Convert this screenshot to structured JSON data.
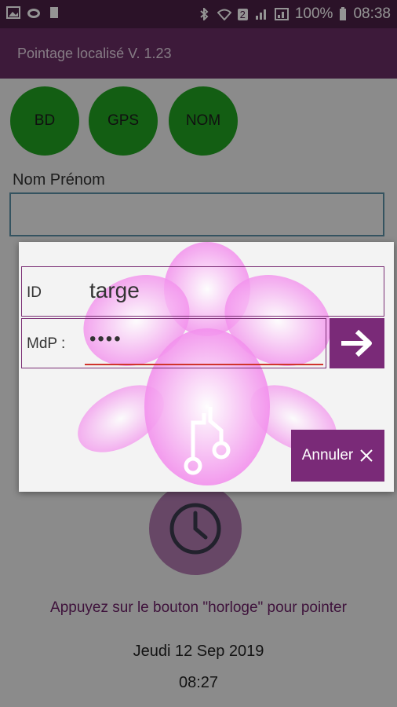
{
  "status_bar": {
    "battery": "100%",
    "time": "08:38",
    "sim_badge": "2"
  },
  "app": {
    "title": "Pointage localisé V. 1.23"
  },
  "quick_buttons": [
    {
      "label": "BD"
    },
    {
      "label": "GPS"
    },
    {
      "label": "NOM"
    }
  ],
  "name_field": {
    "label": "Nom Prénom",
    "value": ""
  },
  "dialog": {
    "id_label": "ID",
    "id_value": "targe",
    "pw_label": "MdP :",
    "pw_value": "••••",
    "cancel_label": "Annuler"
  },
  "instruction": "Appuyez sur le bouton \"horloge\" pour pointer",
  "date": "Jeudi 12 Sep 2019",
  "time": "08:27",
  "colors": {
    "primary": "#6a2d64",
    "accent": "#7a2a78",
    "green": "#22a322"
  }
}
